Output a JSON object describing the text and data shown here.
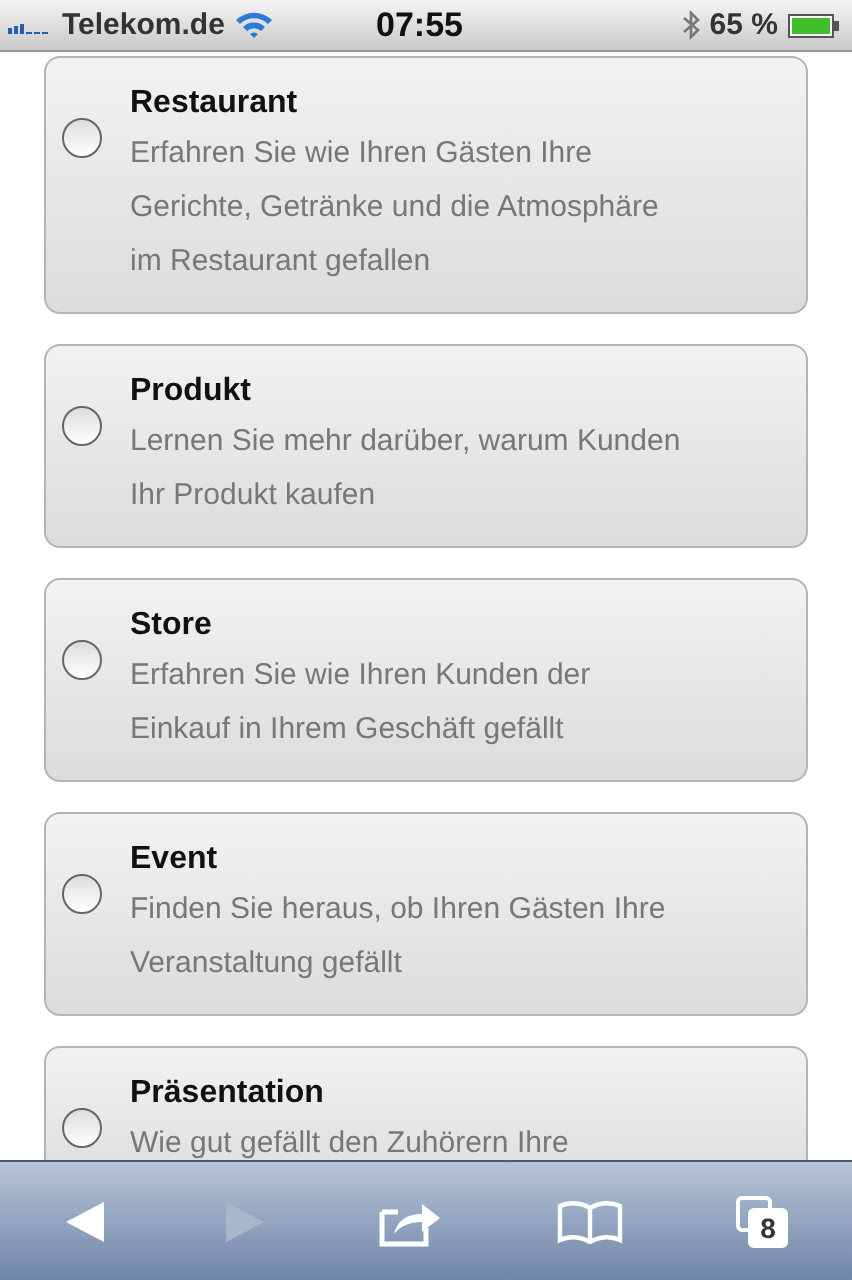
{
  "status_bar": {
    "carrier": "Telekom.de",
    "time": "07:55",
    "battery": "65 %"
  },
  "options": [
    {
      "title": "Restaurant",
      "description": "Erfahren Sie wie Ihren Gästen Ihre\nGerichte, Getränke und die Atmosphäre\nim Restaurant gefallen",
      "selected": false
    },
    {
      "title": "Produkt",
      "description": "Lernen Sie mehr darüber, warum Kunden\nIhr Produkt kaufen",
      "selected": false
    },
    {
      "title": "Store",
      "description": "Erfahren Sie wie Ihren Kunden der\nEinkauf in Ihrem Geschäft gefällt",
      "selected": false
    },
    {
      "title": "Event",
      "description": "Finden Sie heraus, ob Ihren Gästen Ihre\nVeranstaltung gefällt",
      "selected": false
    },
    {
      "title": "Präsentation",
      "description": "Wie gut gefällt den Zuhörern Ihre",
      "selected": false
    }
  ],
  "toolbar": {
    "tab_count": "8"
  }
}
